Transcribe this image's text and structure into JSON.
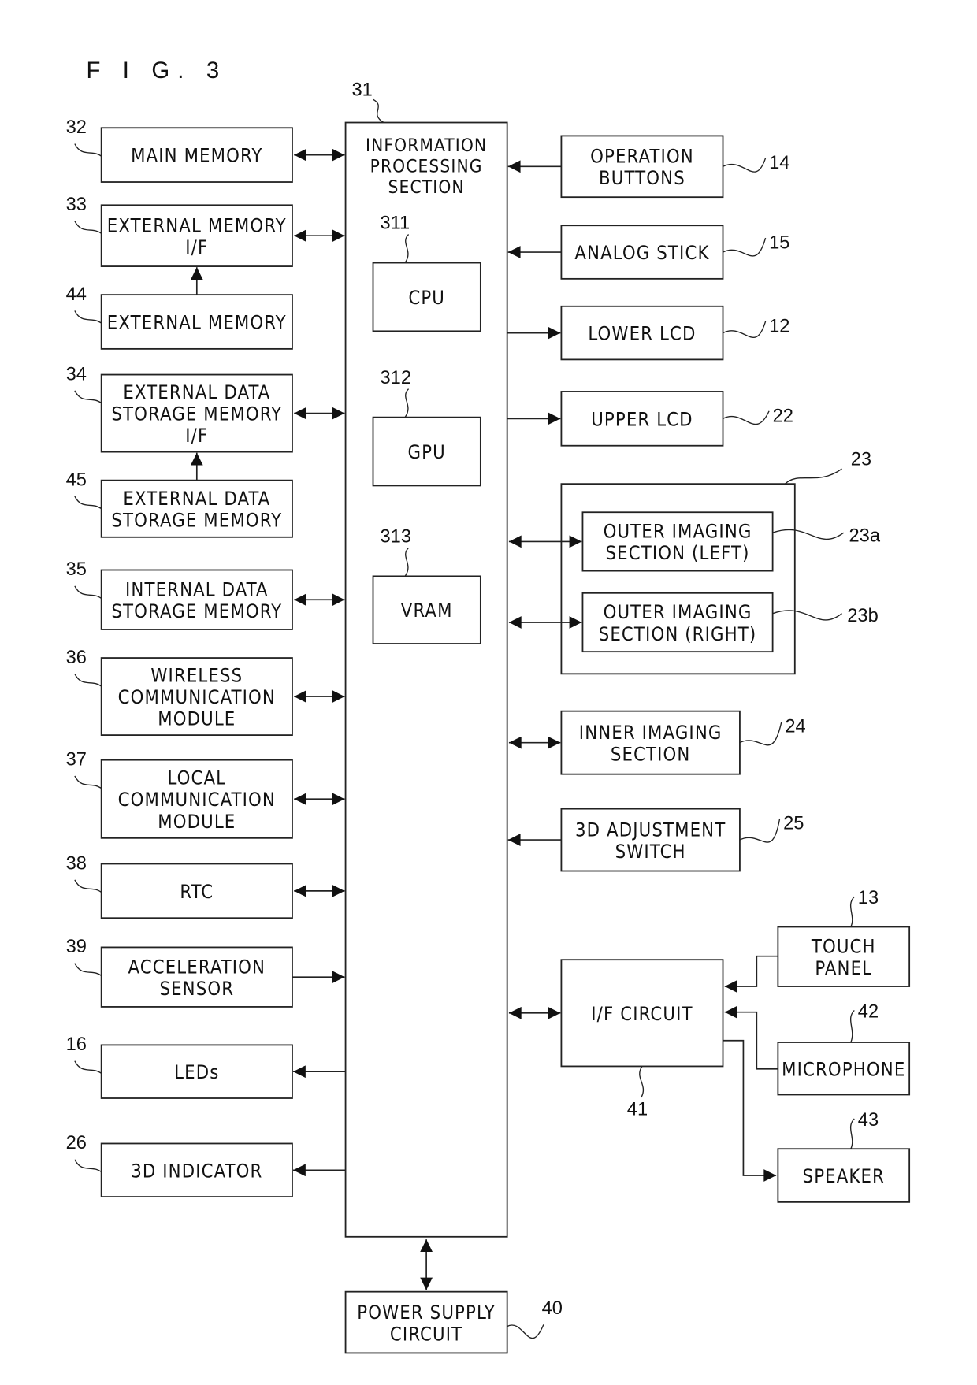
{
  "figure_title": "F I G. 3",
  "central": {
    "ref": "31",
    "lines": [
      "INFORMATION",
      "PROCESSING",
      "SECTION"
    ]
  },
  "sub_blocks": [
    {
      "id": "cpu",
      "ref": "311",
      "label": "CPU"
    },
    {
      "id": "gpu",
      "ref": "312",
      "label": "GPU"
    },
    {
      "id": "vram",
      "ref": "313",
      "label": "VRAM"
    }
  ],
  "left_blocks": [
    {
      "id": "main-memory",
      "ref": "32",
      "lines": [
        "MAIN MEMORY"
      ],
      "link": "bidirectional"
    },
    {
      "id": "external-memory-if",
      "ref": "33",
      "lines": [
        "EXTERNAL MEMORY",
        "I/F"
      ],
      "link": "bidirectional"
    },
    {
      "id": "external-memory",
      "ref": "44",
      "lines": [
        "EXTERNAL MEMORY"
      ],
      "link": "up-to-33"
    },
    {
      "id": "external-data-storage-memory-if",
      "ref": "34",
      "lines": [
        "EXTERNAL DATA",
        "STORAGE MEMORY",
        "I/F"
      ],
      "link": "bidirectional"
    },
    {
      "id": "external-data-storage-memory",
      "ref": "45",
      "lines": [
        "EXTERNAL DATA",
        "STORAGE MEMORY"
      ],
      "link": "up-to-34"
    },
    {
      "id": "internal-data-storage-memory",
      "ref": "35",
      "lines": [
        "INTERNAL DATA",
        "STORAGE MEMORY"
      ],
      "link": "bidirectional"
    },
    {
      "id": "wireless-communication-module",
      "ref": "36",
      "lines": [
        "WIRELESS",
        "COMMUNICATION",
        "MODULE"
      ],
      "link": "bidirectional"
    },
    {
      "id": "local-communication-module",
      "ref": "37",
      "lines": [
        "LOCAL",
        "COMMUNICATION",
        "MODULE"
      ],
      "link": "bidirectional"
    },
    {
      "id": "rtc",
      "ref": "38",
      "lines": [
        "RTC"
      ],
      "link": "bidirectional"
    },
    {
      "id": "acceleration-sensor",
      "ref": "39",
      "lines": [
        "ACCELERATION",
        "SENSOR"
      ],
      "link": "to-central"
    },
    {
      "id": "leds",
      "ref": "16",
      "lines": [
        "LEDs"
      ],
      "link": "from-central"
    },
    {
      "id": "3d-indicator",
      "ref": "26",
      "lines": [
        "3D INDICATOR"
      ],
      "link": "from-central"
    }
  ],
  "right_blocks": [
    {
      "id": "operation-buttons",
      "ref": "14",
      "lines": [
        "OPERATION",
        "BUTTONS"
      ],
      "link": "to-central"
    },
    {
      "id": "analog-stick",
      "ref": "15",
      "lines": [
        "ANALOG STICK"
      ],
      "link": "to-central"
    },
    {
      "id": "lower-lcd",
      "ref": "12",
      "lines": [
        "LOWER LCD"
      ],
      "link": "from-central"
    },
    {
      "id": "upper-lcd",
      "ref": "22",
      "lines": [
        "UPPER LCD"
      ],
      "link": "from-central"
    },
    {
      "id": "outer-imaging-group",
      "ref": "23",
      "lines": [],
      "link": "container"
    },
    {
      "id": "outer-imaging-left",
      "ref": "23a",
      "lines": [
        "OUTER IMAGING",
        "SECTION (LEFT)"
      ],
      "link": "bidirectional"
    },
    {
      "id": "outer-imaging-right",
      "ref": "23b",
      "lines": [
        "OUTER IMAGING",
        "SECTION (RIGHT)"
      ],
      "link": "bidirectional"
    },
    {
      "id": "inner-imaging-section",
      "ref": "24",
      "lines": [
        "INNER IMAGING",
        "SECTION"
      ],
      "link": "bidirectional"
    },
    {
      "id": "3d-adjustment-switch",
      "ref": "25",
      "lines": [
        "3D ADJUSTMENT",
        "SWITCH"
      ],
      "link": "to-central"
    },
    {
      "id": "if-circuit",
      "ref": "41",
      "lines": [
        "I/F CIRCUIT"
      ],
      "link": "bidirectional"
    },
    {
      "id": "touch-panel",
      "ref": "13",
      "lines": [
        "TOUCH",
        "PANEL"
      ],
      "link": "to-if-circuit"
    },
    {
      "id": "microphone",
      "ref": "42",
      "lines": [
        "MICROPHONE"
      ],
      "link": "to-if-circuit"
    },
    {
      "id": "speaker",
      "ref": "43",
      "lines": [
        "SPEAKER"
      ],
      "link": "from-if-circuit"
    }
  ],
  "bottom_block": {
    "id": "power-supply-circuit",
    "ref": "40",
    "lines": [
      "POWER SUPPLY",
      "CIRCUIT"
    ],
    "link": "bidirectional"
  }
}
